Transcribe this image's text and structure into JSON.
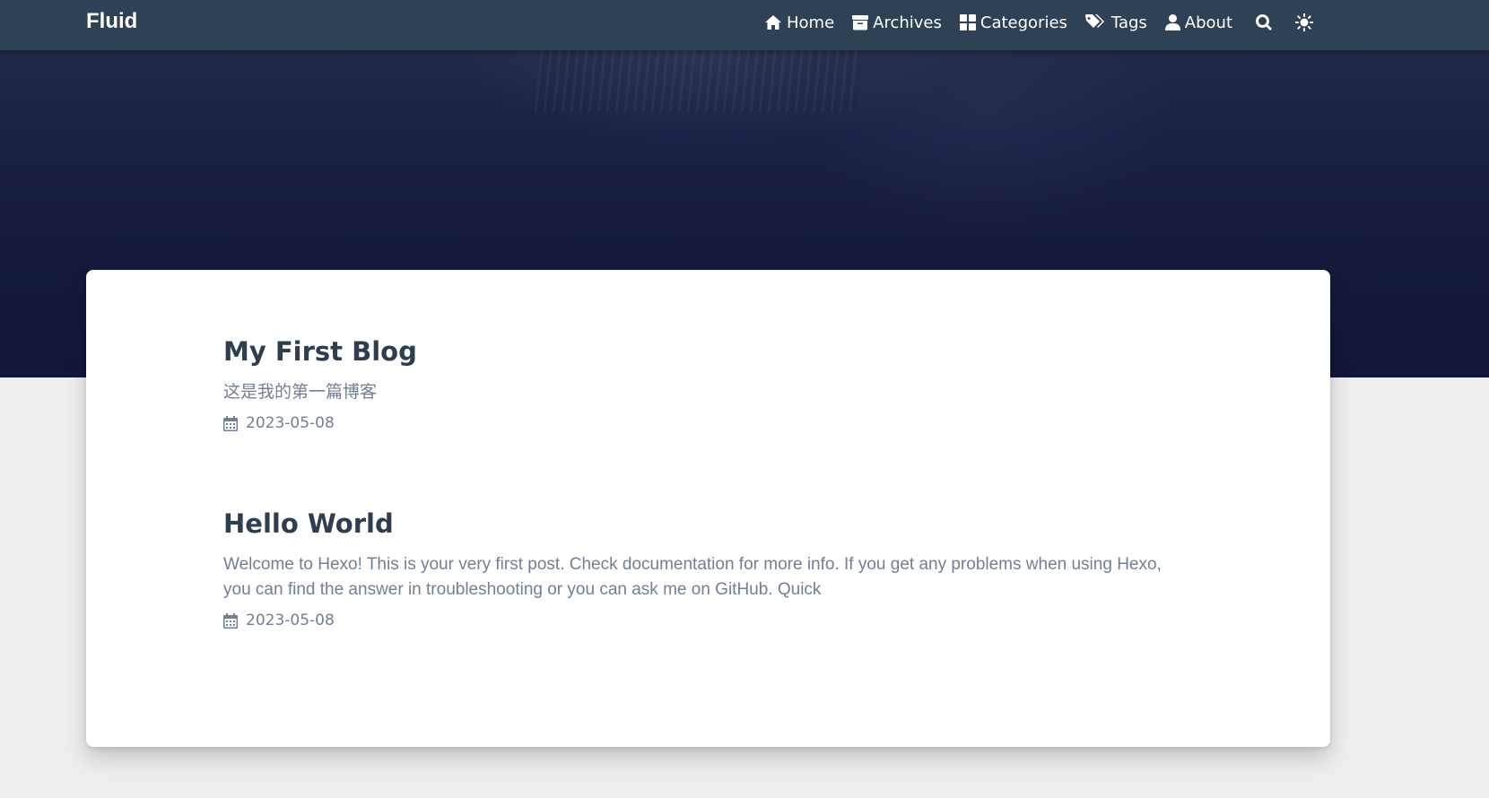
{
  "navbar": {
    "brand": "Fluid",
    "items": [
      {
        "label": "Home",
        "icon": "home-icon"
      },
      {
        "label": "Archives",
        "icon": "archive-icon"
      },
      {
        "label": "Categories",
        "icon": "categories-icon"
      },
      {
        "label": "Tags",
        "icon": "tags-icon"
      },
      {
        "label": "About",
        "icon": "user-icon"
      }
    ],
    "search_icon": "search-icon",
    "theme_icon": "sun-icon"
  },
  "posts": [
    {
      "title": "My First Blog",
      "excerpt": "这是我的第一篇博客",
      "date": "2023-05-08"
    },
    {
      "title": "Hello World",
      "excerpt": "Welcome to Hexo! This is your very first post. Check documentation for more info. If you get any problems when using Hexo, you can find the answer in troubleshooting or you can ask me on GitHub. Quick",
      "date": "2023-05-08"
    }
  ],
  "colors": {
    "navbar_bg": "#2f4154",
    "banner_bg": "#161b3d",
    "page_bg": "#eeeeee",
    "title": "#2c3e50",
    "muted": "#718096"
  }
}
